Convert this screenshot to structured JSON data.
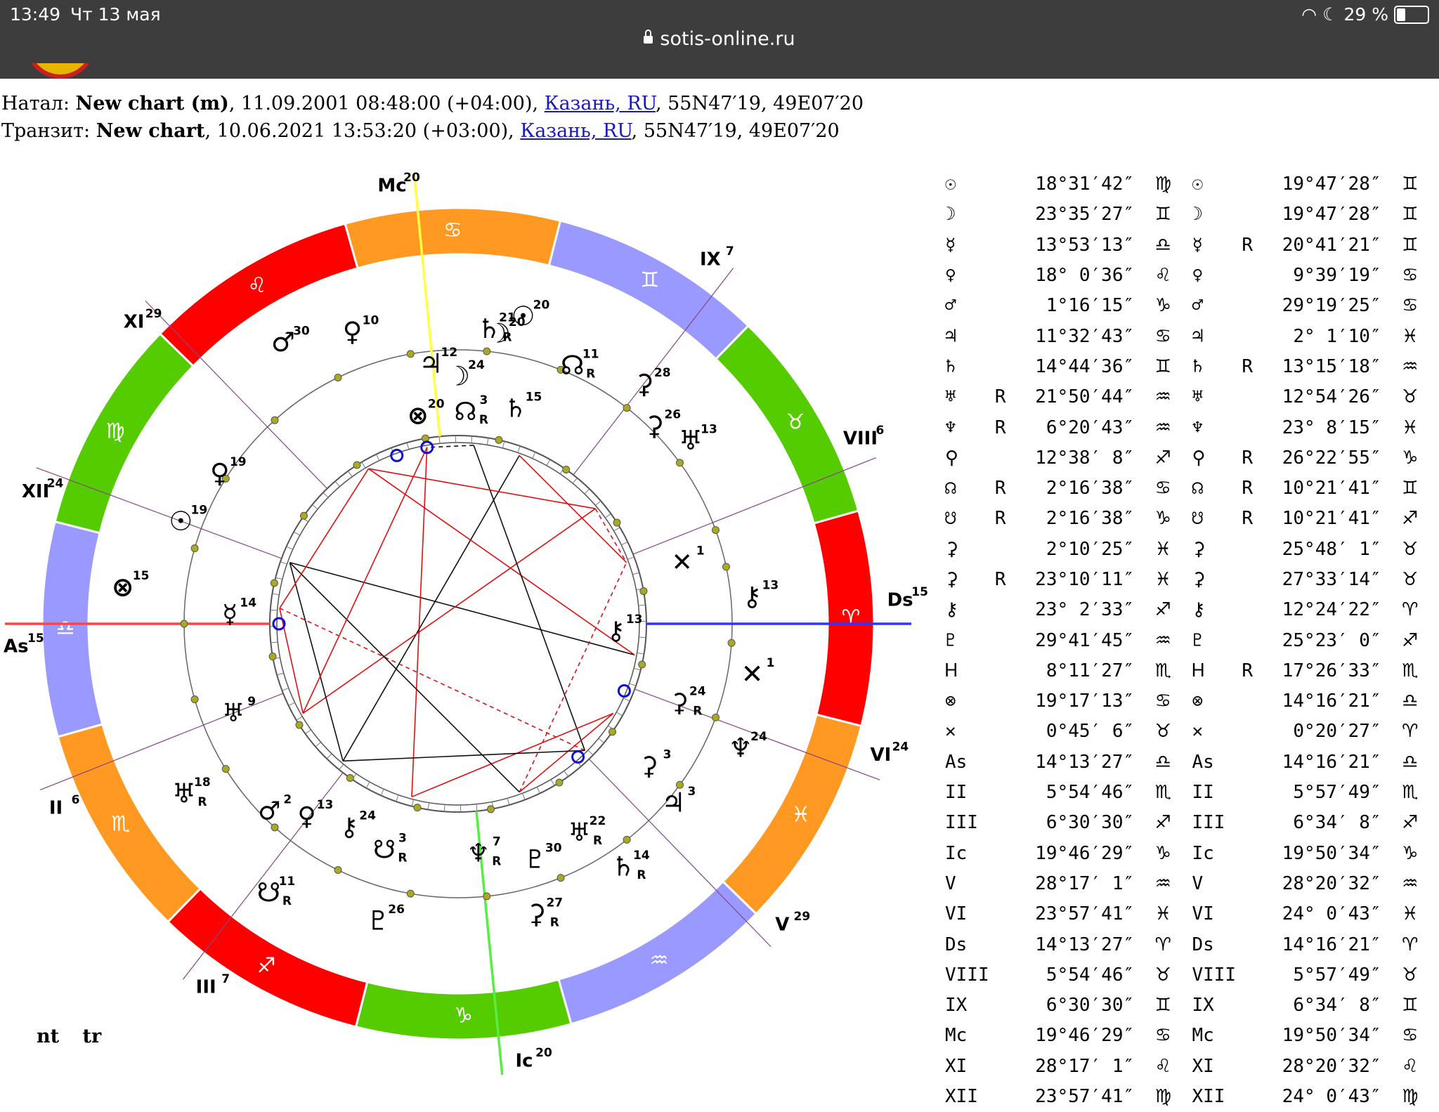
{
  "status_bar": {
    "time": "13:49",
    "date": "Чт 13 мая",
    "battery": "29 %",
    "battery_level": 0.29,
    "url": "sotis-online.ru"
  },
  "header": {
    "natal_label": "Натал:",
    "natal_name": "New chart (m)",
    "natal_datetime": ", 11.09.2001 08:48:00 (+04:00), ",
    "natal_place": "Казань, RU",
    "natal_coords": ", 55N47′19, 49E07′20",
    "transit_label": "Транзит:",
    "transit_name": "New chart",
    "transit_datetime": ", 10.06.2021 13:53:20 (+03:00), ",
    "transit_place": "Казань, RU",
    "transit_coords": ", 55N47′19, 49E07′20"
  },
  "legend": {
    "natal": "nt",
    "transit": "tr"
  },
  "colors": {
    "fire": "#ff0000",
    "earth": "#55cc00",
    "air": "#9999ff",
    "water": "#ff9922",
    "asc_line": "#ff4444",
    "dsc_line": "#3333ff",
    "mc_line": "#ffff44",
    "ic_line": "#55ee44"
  },
  "chart": {
    "signs": [
      "♈",
      "♉",
      "♊",
      "♋",
      "♌",
      "♍",
      "♎",
      "♏",
      "♐",
      "♑",
      "♒",
      "♓"
    ],
    "cusps": [
      {
        "label": "As",
        "deg": "15"
      },
      {
        "label": "II",
        "deg": "6"
      },
      {
        "label": "III",
        "deg": "7"
      },
      {
        "label": "Ic",
        "deg": "20"
      },
      {
        "label": "V",
        "deg": "29"
      },
      {
        "label": "VI",
        "deg": "24"
      },
      {
        "label": "Ds",
        "deg": "15"
      },
      {
        "label": "VIII",
        "deg": "6"
      },
      {
        "label": "IX",
        "deg": "7"
      },
      {
        "label": "Mc",
        "deg": "20"
      },
      {
        "label": "XI",
        "deg": "29"
      },
      {
        "label": "XII",
        "deg": "24"
      }
    ],
    "outer_bodies": [
      {
        "g": "♂",
        "d": "30",
        "r": ""
      },
      {
        "g": "♀",
        "d": "10",
        "r": ""
      },
      {
        "g": "☉",
        "d": "20",
        "r": ""
      },
      {
        "g": "♄",
        "d": "21",
        "r": "R"
      },
      {
        "g": "☽",
        "d": "20",
        "r": ""
      },
      {
        "g": "☊",
        "d": "11",
        "r": "R"
      },
      {
        "g": "⚳",
        "d": "28",
        "r": ""
      },
      {
        "g": "⚳",
        "d": "26",
        "r": ""
      },
      {
        "g": "♅",
        "d": "13",
        "r": ""
      },
      {
        "g": "♃",
        "d": "12",
        "r": ""
      },
      {
        "g": "☽",
        "d": "24",
        "r": ""
      },
      {
        "g": "⊗",
        "d": "15",
        "r": ""
      },
      {
        "g": "⚷",
        "d": "13",
        "r": ""
      },
      {
        "g": "✕",
        "d": "1",
        "r": ""
      },
      {
        "g": "♆",
        "d": "24",
        "r": ""
      },
      {
        "g": "♃",
        "d": "3",
        "r": ""
      },
      {
        "g": "♄",
        "d": "14",
        "r": "R"
      },
      {
        "g": "⚳",
        "d": "27",
        "r": "R"
      },
      {
        "g": "♇",
        "d": "26",
        "r": ""
      },
      {
        "g": "☋",
        "d": "11",
        "r": "R"
      },
      {
        "g": "♅",
        "d": "18",
        "r": "R"
      },
      {
        "g": "☉",
        "d": "19",
        "r": ""
      },
      {
        "g": "♀",
        "d": "19",
        "r": ""
      }
    ],
    "inner_bodies": [
      {
        "g": "⊗",
        "d": "20",
        "r": ""
      },
      {
        "g": "☊",
        "d": "3",
        "r": "R"
      },
      {
        "g": "♄",
        "d": "15",
        "r": ""
      },
      {
        "g": "✕",
        "d": "1",
        "r": ""
      },
      {
        "g": "⚷",
        "d": "13",
        "r": ""
      },
      {
        "g": "⚳",
        "d": "24",
        "r": "R"
      },
      {
        "g": "⚳",
        "d": "3",
        "r": ""
      },
      {
        "g": "♅",
        "d": "22",
        "r": "R"
      },
      {
        "g": "♇",
        "d": "30",
        "r": ""
      },
      {
        "g": "♆",
        "d": "7",
        "r": "R"
      },
      {
        "g": "☋",
        "d": "3",
        "r": "R"
      },
      {
        "g": "⚷",
        "d": "24",
        "r": ""
      },
      {
        "g": "♀",
        "d": "13",
        "r": ""
      },
      {
        "g": "♂",
        "d": "2",
        "r": ""
      },
      {
        "g": "♅",
        "d": "9",
        "r": ""
      },
      {
        "g": "☿",
        "d": "14",
        "r": ""
      }
    ]
  },
  "positions": [
    {
      "g1": "☉",
      "r1": "",
      "v1": "18°31′42″",
      "s1": "♍",
      "g2": "☉",
      "r2": "",
      "v2": "19°47′28″",
      "s2": "♊"
    },
    {
      "g1": "☽",
      "r1": "",
      "v1": "23°35′27″",
      "s1": "♊",
      "g2": "☽",
      "r2": "",
      "v2": "19°47′28″",
      "s2": "♊"
    },
    {
      "g1": "☿",
      "r1": "",
      "v1": "13°53′13″",
      "s1": "♎",
      "g2": "☿",
      "r2": "R",
      "v2": "20°41′21″",
      "s2": "♊"
    },
    {
      "g1": "♀",
      "r1": "",
      "v1": "18° 0′36″",
      "s1": "♌",
      "g2": "♀",
      "r2": "",
      "v2": "9°39′19″",
      "s2": "♋"
    },
    {
      "g1": "♂",
      "r1": "",
      "v1": "1°16′15″",
      "s1": "♑",
      "g2": "♂",
      "r2": "",
      "v2": "29°19′25″",
      "s2": "♋"
    },
    {
      "g1": "♃",
      "r1": "",
      "v1": "11°32′43″",
      "s1": "♋",
      "g2": "♃",
      "r2": "",
      "v2": "2° 1′10″",
      "s2": "♓"
    },
    {
      "g1": "♄",
      "r1": "",
      "v1": "14°44′36″",
      "s1": "♊",
      "g2": "♄",
      "r2": "R",
      "v2": "13°15′18″",
      "s2": "♒"
    },
    {
      "g1": "♅",
      "r1": "R",
      "v1": "21°50′44″",
      "s1": "♒",
      "g2": "♅",
      "r2": "",
      "v2": "12°54′26″",
      "s2": "♉"
    },
    {
      "g1": "♆",
      "r1": "R",
      "v1": "6°20′43″",
      "s1": "♒",
      "g2": "♆",
      "r2": "",
      "v2": "23° 8′15″",
      "s2": "♓"
    },
    {
      "g1": "⚲",
      "r1": "",
      "v1": "12°38′ 8″",
      "s1": "♐",
      "g2": "⚲",
      "r2": "R",
      "v2": "26°22′55″",
      "s2": "♑"
    },
    {
      "g1": "☊",
      "r1": "R",
      "v1": "2°16′38″",
      "s1": "♋",
      "g2": "☊",
      "r2": "R",
      "v2": "10°21′41″",
      "s2": "♊"
    },
    {
      "g1": "☋",
      "r1": "R",
      "v1": "2°16′38″",
      "s1": "♑",
      "g2": "☋",
      "r2": "R",
      "v2": "10°21′41″",
      "s2": "♐"
    },
    {
      "g1": "⚳",
      "r1": "",
      "v1": "2°10′25″",
      "s1": "♓",
      "g2": "⚳",
      "r2": "",
      "v2": "25°48′ 1″",
      "s2": "♉"
    },
    {
      "g1": "⚳",
      "r1": "R",
      "v1": "23°10′11″",
      "s1": "♓",
      "g2": "⚳",
      "r2": "",
      "v2": "27°33′14″",
      "s2": "♉"
    },
    {
      "g1": "⚷",
      "r1": "",
      "v1": "23° 2′33″",
      "s1": "♐",
      "g2": "⚷",
      "r2": "",
      "v2": "12°24′22″",
      "s2": "♈"
    },
    {
      "g1": "♇",
      "r1": "",
      "v1": "29°41′45″",
      "s1": "♒",
      "g2": "♇",
      "r2": "",
      "v2": "25°23′ 0″",
      "s2": "♐"
    },
    {
      "g1": "Ꮋ",
      "r1": "",
      "v1": "8°11′27″",
      "s1": "♏",
      "g2": "Ꮋ",
      "r2": "R",
      "v2": "17°26′33″",
      "s2": "♏"
    },
    {
      "g1": "⊗",
      "r1": "",
      "v1": "19°17′13″",
      "s1": "♋",
      "g2": "⊗",
      "r2": "",
      "v2": "14°16′21″",
      "s2": "♎"
    },
    {
      "g1": "✕",
      "r1": "",
      "v1": "0°45′ 6″",
      "s1": "♉",
      "g2": "✕",
      "r2": "",
      "v2": "0°20′27″",
      "s2": "♈"
    },
    {
      "g1": "As",
      "r1": "",
      "v1": "14°13′27″",
      "s1": "♎",
      "g2": "As",
      "r2": "",
      "v2": "14°16′21″",
      "s2": "♎"
    },
    {
      "g1": "II",
      "r1": "",
      "v1": "5°54′46″",
      "s1": "♏",
      "g2": "II",
      "r2": "",
      "v2": "5°57′49″",
      "s2": "♏"
    },
    {
      "g1": "III",
      "r1": "",
      "v1": "6°30′30″",
      "s1": "♐",
      "g2": "III",
      "r2": "",
      "v2": "6°34′ 8″",
      "s2": "♐"
    },
    {
      "g1": "Ic",
      "r1": "",
      "v1": "19°46′29″",
      "s1": "♑",
      "g2": "Ic",
      "r2": "",
      "v2": "19°50′34″",
      "s2": "♑"
    },
    {
      "g1": "V",
      "r1": "",
      "v1": "28°17′ 1″",
      "s1": "♒",
      "g2": "V",
      "r2": "",
      "v2": "28°20′32″",
      "s2": "♒"
    },
    {
      "g1": "VI",
      "r1": "",
      "v1": "23°57′41″",
      "s1": "♓",
      "g2": "VI",
      "r2": "",
      "v2": "24° 0′43″",
      "s2": "♓"
    },
    {
      "g1": "Ds",
      "r1": "",
      "v1": "14°13′27″",
      "s1": "♈",
      "g2": "Ds",
      "r2": "",
      "v2": "14°16′21″",
      "s2": "♈"
    },
    {
      "g1": "VIII",
      "r1": "",
      "v1": "5°54′46″",
      "s1": "♉",
      "g2": "VIII",
      "r2": "",
      "v2": "5°57′49″",
      "s2": "♉"
    },
    {
      "g1": "IX",
      "r1": "",
      "v1": "6°30′30″",
      "s1": "♊",
      "g2": "IX",
      "r2": "",
      "v2": "6°34′ 8″",
      "s2": "♊"
    },
    {
      "g1": "Mc",
      "r1": "",
      "v1": "19°46′29″",
      "s1": "♋",
      "g2": "Mc",
      "r2": "",
      "v2": "19°50′34″",
      "s2": "♋"
    },
    {
      "g1": "XI",
      "r1": "",
      "v1": "28°17′ 1″",
      "s1": "♌",
      "g2": "XI",
      "r2": "",
      "v2": "28°20′32″",
      "s2": "♌"
    },
    {
      "g1": "XII",
      "r1": "",
      "v1": "23°57′41″",
      "s1": "♍",
      "g2": "XII",
      "r2": "",
      "v2": "24° 0′43″",
      "s2": "♍"
    }
  ]
}
